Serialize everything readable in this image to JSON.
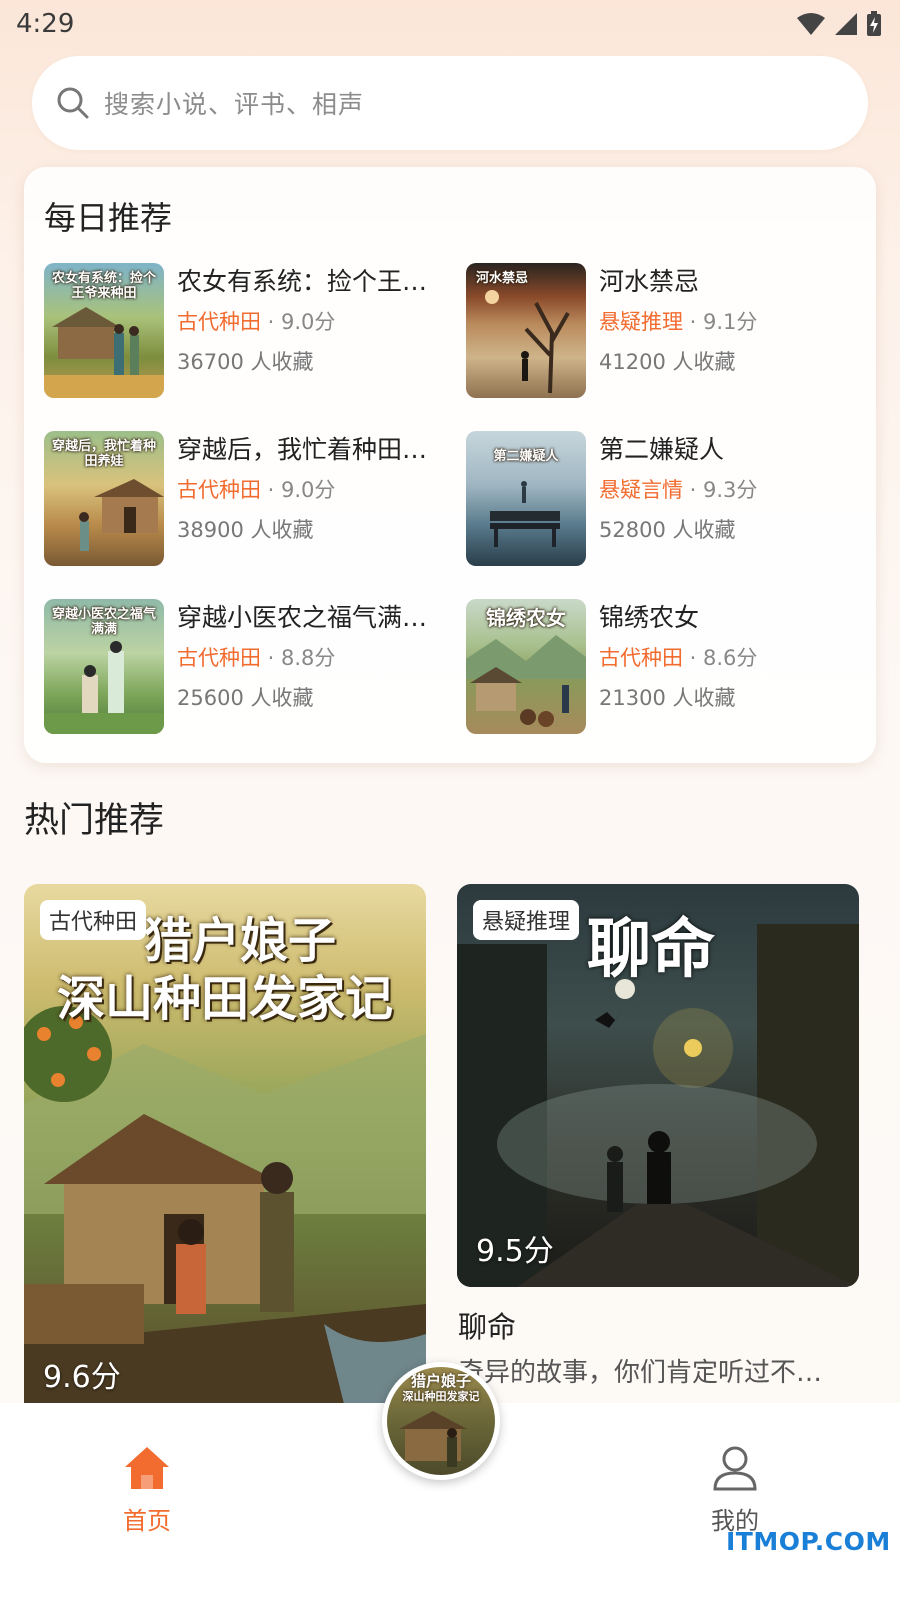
{
  "status_bar": {
    "time": "4:29"
  },
  "search": {
    "placeholder": "搜索小说、评书、相声"
  },
  "daily": {
    "title": "每日推荐",
    "books": [
      {
        "title": "农女有系统：捡个王…",
        "cover_text": "农女有系统：捡个王爷来种田",
        "genre": "古代种田",
        "score": " · 9.0分",
        "favorites": "36700 人收藏"
      },
      {
        "title": "河水禁忌",
        "cover_text": "河水禁忌",
        "genre": "悬疑推理",
        "score": " · 9.1分",
        "favorites": "41200 人收藏"
      },
      {
        "title": "穿越后，我忙着种田…",
        "cover_text": "穿越后，我忙着种田养娃",
        "genre": "古代种田",
        "score": " · 9.0分",
        "favorites": "38900 人收藏"
      },
      {
        "title": "第二嫌疑人",
        "cover_text": "第二嫌疑人",
        "genre": "悬疑言情",
        "score": " · 9.3分",
        "favorites": "52800 人收藏"
      },
      {
        "title": "穿越小医农之福气满…",
        "cover_text": "穿越小医农之福气满满",
        "genre": "古代种田",
        "score": " · 8.8分",
        "favorites": "25600 人收藏"
      },
      {
        "title": "锦绣农女",
        "cover_text": "锦绣农女",
        "genre": "古代种田",
        "score": " · 8.6分",
        "favorites": "21300 人收藏"
      }
    ]
  },
  "hot": {
    "title": "热门推荐",
    "items": [
      {
        "tag": "古代种田",
        "cover_line1": "猎户娘子",
        "cover_line2": "深山种田发家记",
        "score": "9.6分"
      },
      {
        "tag": "悬疑推理",
        "cover_title": "聊命",
        "score": "9.5分",
        "title": "聊命",
        "desc": "奇异的故事，你们肯定听过不少吧"
      }
    ]
  },
  "player": {
    "cover_line1": "猎户娘子",
    "cover_line2": "深山种田发家记"
  },
  "nav": {
    "home": "首页",
    "mine": "我的"
  },
  "watermark": "ITMOP.COM",
  "colors": {
    "accent": "#f26b2f",
    "watermark": "#1a7fd6"
  },
  "icons": [
    "search-icon",
    "wifi-icon",
    "signal-icon",
    "battery-icon",
    "home-icon",
    "user-icon"
  ]
}
